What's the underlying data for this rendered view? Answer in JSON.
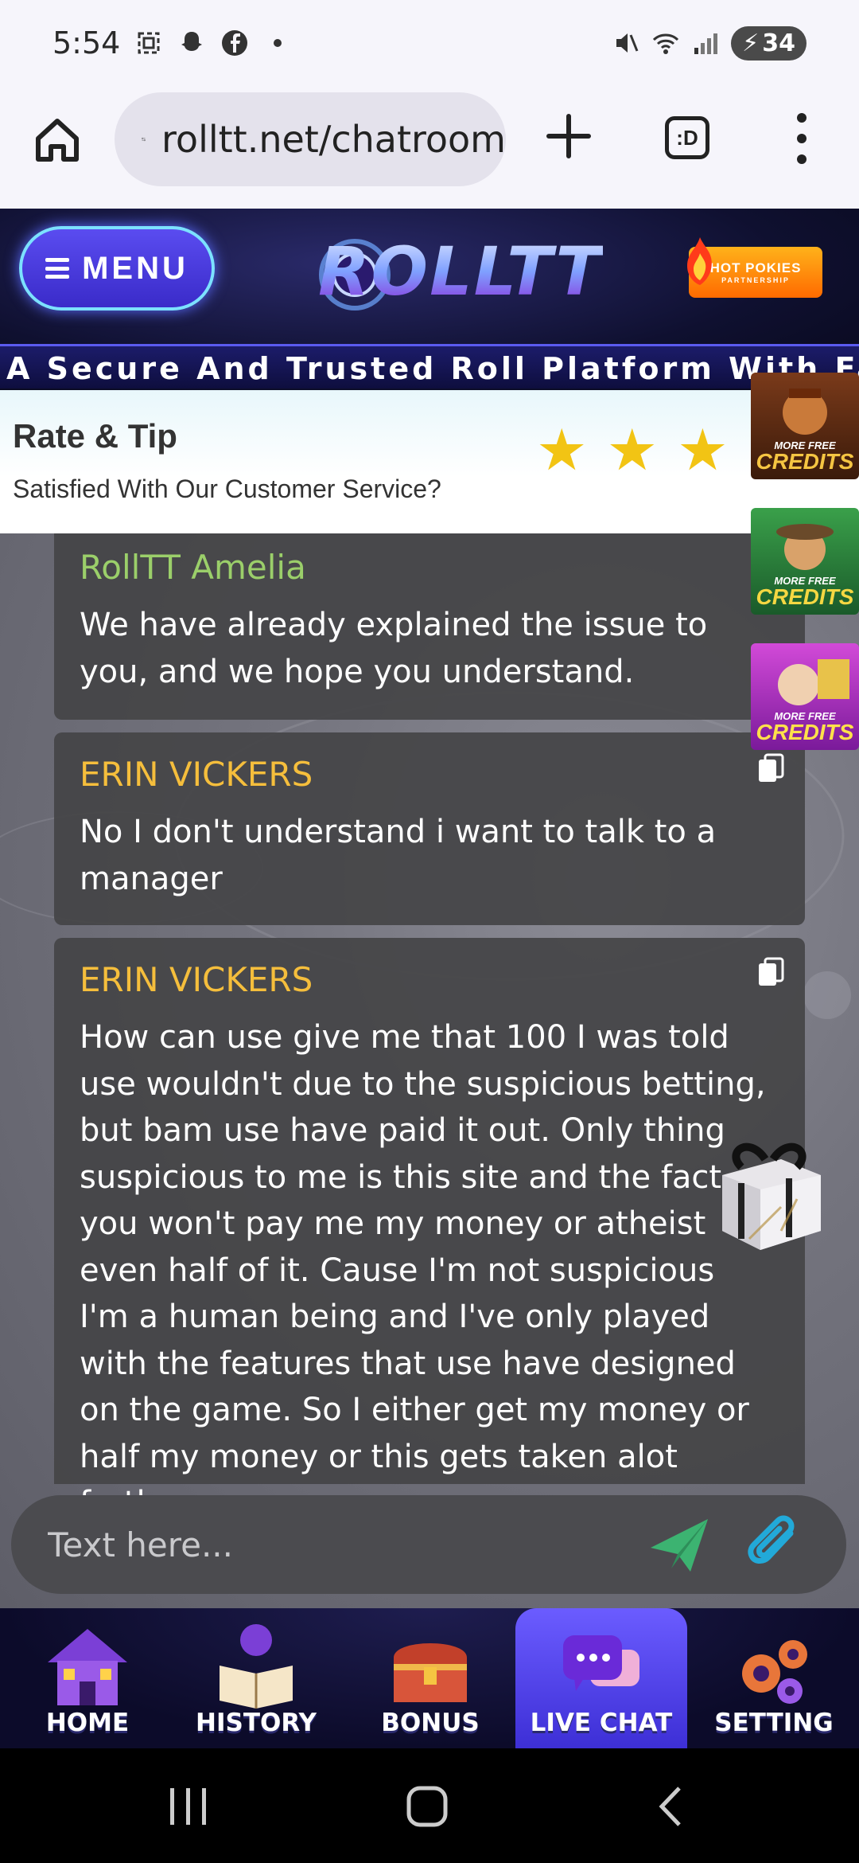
{
  "status_bar": {
    "time": "5:54",
    "battery": "34",
    "icons": [
      "screenshot-icon",
      "snapchat-icon",
      "facebook-icon",
      "dot-icon",
      "mute-icon",
      "wifi-icon",
      "signal-icon",
      "battery-icon"
    ]
  },
  "browser": {
    "url": "rolltt.net/chatroom",
    "tabs_label": ":D"
  },
  "site": {
    "menu_label": "MENU",
    "logo_text": "ROLLTT",
    "partner_main": "HOT POKIES",
    "partner_sub": "PARTNERSHIP",
    "banner": "A Secure And Trusted Roll Platform With Fair"
  },
  "rate_tip": {
    "title": "Rate & Tip",
    "subtitle": "Satisfied With Our Customer Service?",
    "stars": 5
  },
  "messages": [
    {
      "name": "RollTT Amelia",
      "name_color": "#9bcf6a",
      "text": "We have already explained the issue to you, and we hope you understand."
    },
    {
      "name": "ERIN VICKERS",
      "name_color": "#f5be3c",
      "text": "No I don't understand i want to talk to a manager"
    },
    {
      "name": "ERIN VICKERS",
      "name_color": "#f5be3c",
      "text": "How can use give me that 100 I was told use wouldn't due to the suspicious betting, but bam use have paid it out. Only thing suspicious to me is this site and the fact you won't pay me my money or atheist even half of it. Cause I'm not suspicious I'm a human being and I've only played with the features that use have designed on the game. So I either get my money or half my money or this gets taken alot further."
    }
  ],
  "promos": [
    {
      "small": "MORE FREE",
      "big": "CREDITS",
      "badge": "Rudolph",
      "color": "#f5c542"
    },
    {
      "small": "MORE FREE",
      "big": "CREDITS",
      "badge": "Blitz Spin",
      "color": "#f5d742"
    },
    {
      "small": "MORE FREE",
      "big": "CREDITS",
      "badge": "I Love Math",
      "color": "#ffe14a"
    }
  ],
  "input": {
    "placeholder": "Text here..."
  },
  "nav": {
    "items": [
      {
        "label": "HOME",
        "icon": "house-icon"
      },
      {
        "label": "HISTORY",
        "icon": "book-icon"
      },
      {
        "label": "BONUS",
        "icon": "treasure-chest-icon"
      },
      {
        "label": "LIVE CHAT",
        "icon": "chat-bubbles-icon"
      },
      {
        "label": "SETTING",
        "icon": "gears-icon"
      }
    ],
    "active": "LIVE CHAT"
  },
  "colors": {
    "accent": "#3d2fd6",
    "star": "#f2c414",
    "send": "#3cb371",
    "attach": "#22a9d8"
  }
}
